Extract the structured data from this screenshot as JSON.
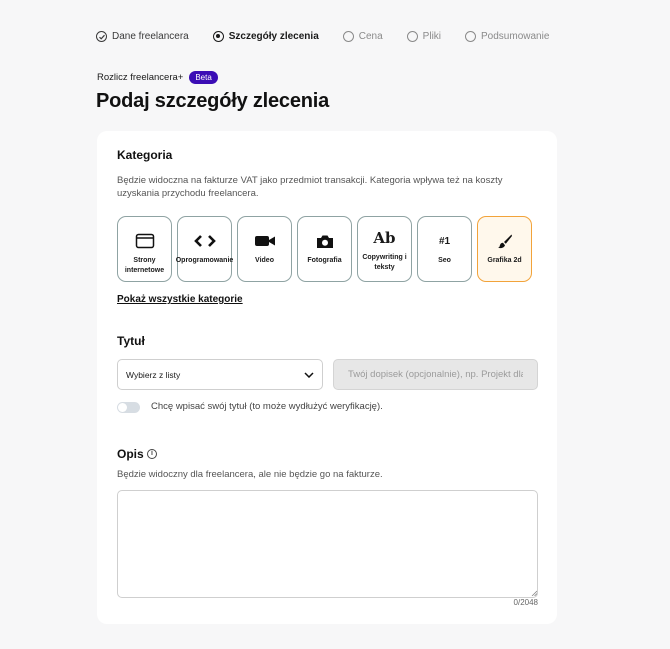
{
  "stepper": [
    {
      "label": "Dane freelancera",
      "state": "done"
    },
    {
      "label": "Szczegóły zlecenia",
      "state": "active"
    },
    {
      "label": "Cena",
      "state": "pending"
    },
    {
      "label": "Pliki",
      "state": "pending"
    },
    {
      "label": "Podsumowanie",
      "state": "pending"
    }
  ],
  "brand": {
    "name": "Rozlicz freelancera+",
    "badge": "Beta"
  },
  "page_title": "Podaj szczegóły zlecenia",
  "category": {
    "title": "Kategoria",
    "description": "Będzie widoczna na fakturze VAT jako przedmiot transakcji. Kategoria wpływa też na koszty uzyskania przychodu freelancera.",
    "items": [
      {
        "label": "Strony internetowe",
        "icon": "browser-window-icon",
        "selected": false
      },
      {
        "label": "Oprogramowanie",
        "icon": "code-brackets-icon",
        "selected": false
      },
      {
        "label": "Video",
        "icon": "video-camera-icon",
        "selected": false
      },
      {
        "label": "Fotografia",
        "icon": "photo-camera-icon",
        "selected": false
      },
      {
        "label": "Copywriting i teksty",
        "icon": "ab-text-icon",
        "icon_text": "Ab",
        "selected": false
      },
      {
        "label": "Seo",
        "icon": "hashtag-one-icon",
        "icon_text": "#1",
        "selected": false
      },
      {
        "label": "Grafika 2d",
        "icon": "brush-icon",
        "selected": true
      }
    ],
    "show_all": "Pokaż wszystkie kategorie"
  },
  "title_section": {
    "title": "Tytuł",
    "select_value": "Wybierz z listy",
    "suffix_placeholder": "Twój dopisek (opcjonalnie), np. Projekt dla...",
    "toggle_label": "Chcę wpisać swój tytuł (to może wydłużyć weryfikację).",
    "toggle_on": false
  },
  "description_section": {
    "title": "Opis",
    "info_icon": "info-icon",
    "hint": "Będzie widoczny dla freelancera, ale nie będzie go na fakturze.",
    "counter": "0/2048"
  },
  "colors": {
    "accent": "#3b0db5",
    "selected_border": "#f2a33a",
    "card_border": "#8fa3a3"
  }
}
